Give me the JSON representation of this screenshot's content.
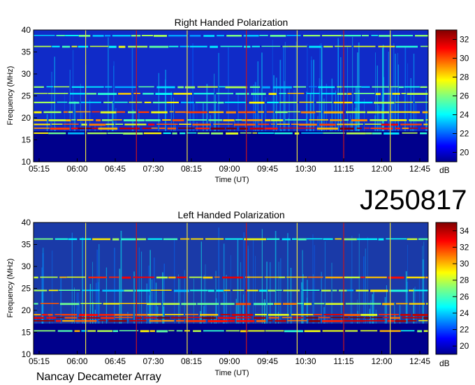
{
  "chart_data": [
    {
      "type": "heatmap",
      "title": "Right Handed Polarization",
      "xlabel": "Time (UT)",
      "ylabel": "Frequency (MHz)",
      "x_ticks": [
        "05:15",
        "06:00",
        "06:45",
        "07:30",
        "08:15",
        "09:00",
        "09:45",
        "10:30",
        "11:15",
        "12:00",
        "12:45"
      ],
      "y_ticks": [
        10,
        15,
        20,
        25,
        30,
        35,
        40
      ],
      "ylim": [
        10,
        40
      ],
      "colorbar": {
        "label": "dB",
        "ticks": [
          20,
          22,
          24,
          26,
          28,
          30,
          32
        ],
        "range": [
          19,
          33
        ]
      },
      "colormap": "jet",
      "vertical_markers": [
        "06:10",
        "07:10",
        "08:10",
        "09:20",
        "10:20",
        "11:15",
        "12:10"
      ],
      "bands": [
        {
          "f": 16.5,
          "intensity": 0.55
        },
        {
          "f": 17.6,
          "intensity": 0.95
        },
        {
          "f": 18.5,
          "intensity": 0.8
        },
        {
          "f": 19.5,
          "intensity": 0.7
        },
        {
          "f": 21.3,
          "intensity": 0.75
        },
        {
          "f": 23.5,
          "intensity": 0.55
        },
        {
          "f": 25.5,
          "intensity": 0.6
        },
        {
          "f": 27.0,
          "intensity": 0.5
        },
        {
          "f": 36.2,
          "intensity": 0.55
        },
        {
          "f": 38.7,
          "intensity": 0.45
        }
      ]
    },
    {
      "type": "heatmap",
      "title": "Left Handed Polarization",
      "xlabel": "Time (UT)",
      "ylabel": "Frequency (MHz)",
      "x_ticks": [
        "05:15",
        "06:00",
        "06:45",
        "07:30",
        "08:15",
        "09:00",
        "09:45",
        "10:30",
        "11:15",
        "12:00",
        "12:45"
      ],
      "y_ticks": [
        10,
        15,
        20,
        25,
        30,
        35,
        40
      ],
      "ylim": [
        10,
        40
      ],
      "colorbar": {
        "label": "dB",
        "ticks": [
          20,
          22,
          24,
          26,
          28,
          30,
          32,
          34
        ],
        "range": [
          19,
          35
        ]
      },
      "colormap": "jet",
      "vertical_markers": [
        "06:10",
        "07:10",
        "08:10",
        "09:20",
        "10:20",
        "11:15",
        "12:10"
      ],
      "bands": [
        {
          "f": 15.3,
          "intensity": 0.6
        },
        {
          "f": 17.6,
          "intensity": 0.9
        },
        {
          "f": 18.3,
          "intensity": 1.0
        },
        {
          "f": 19.0,
          "intensity": 0.85
        },
        {
          "f": 21.5,
          "intensity": 0.7
        },
        {
          "f": 24.5,
          "intensity": 0.55
        },
        {
          "f": 27.5,
          "intensity": 0.8
        },
        {
          "f": 36.2,
          "intensity": 0.6
        }
      ]
    }
  ],
  "labels": {
    "code": "J250817",
    "footer": "Nancay Decameter Array"
  }
}
